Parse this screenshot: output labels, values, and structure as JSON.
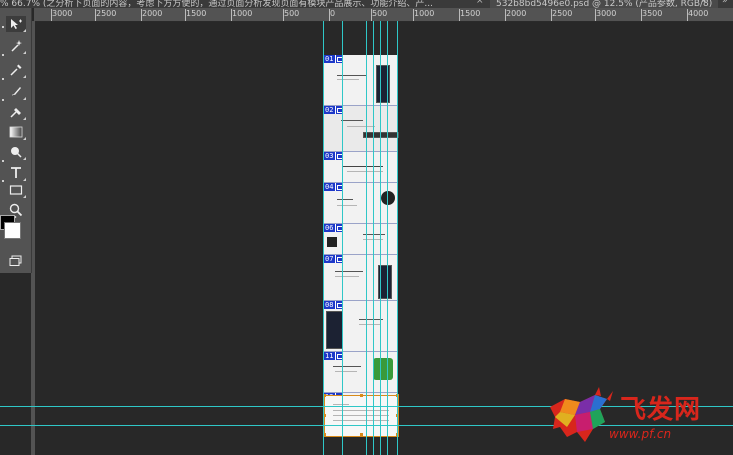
{
  "tabs": {
    "left_tab_text": "% 66.7% (之分析下页面的内容，考虑下方方便的，通过页面分析发现页面有模块产品展示、功能介绍、产...",
    "right_tab_text": "532b8bd5496e0.psd @ 12.5% (产品参数, RGB/8)",
    "close_glyph": "×",
    "overflow_glyph": "»"
  },
  "ruler": {
    "labels": [
      "3000",
      "2500",
      "2000",
      "1500",
      "1000",
      "500",
      "0",
      "500",
      "1000",
      "1500",
      "2000",
      "2500",
      "3000",
      "3500",
      "4000"
    ]
  },
  "slices": [
    {
      "num": "01"
    },
    {
      "num": "02"
    },
    {
      "num": "03"
    },
    {
      "num": "04"
    },
    {
      "num": "06"
    },
    {
      "num": "07"
    },
    {
      "num": "08"
    },
    {
      "num": "11"
    },
    {
      "num": "12"
    }
  ],
  "watermark": {
    "logo_text": "飞发网",
    "url": "www.pf.cn"
  },
  "colors": {
    "guide": "#2fc7c7",
    "slice": "#1d38c9",
    "selection": "#d88a1a",
    "watermark": "#d8261c"
  }
}
